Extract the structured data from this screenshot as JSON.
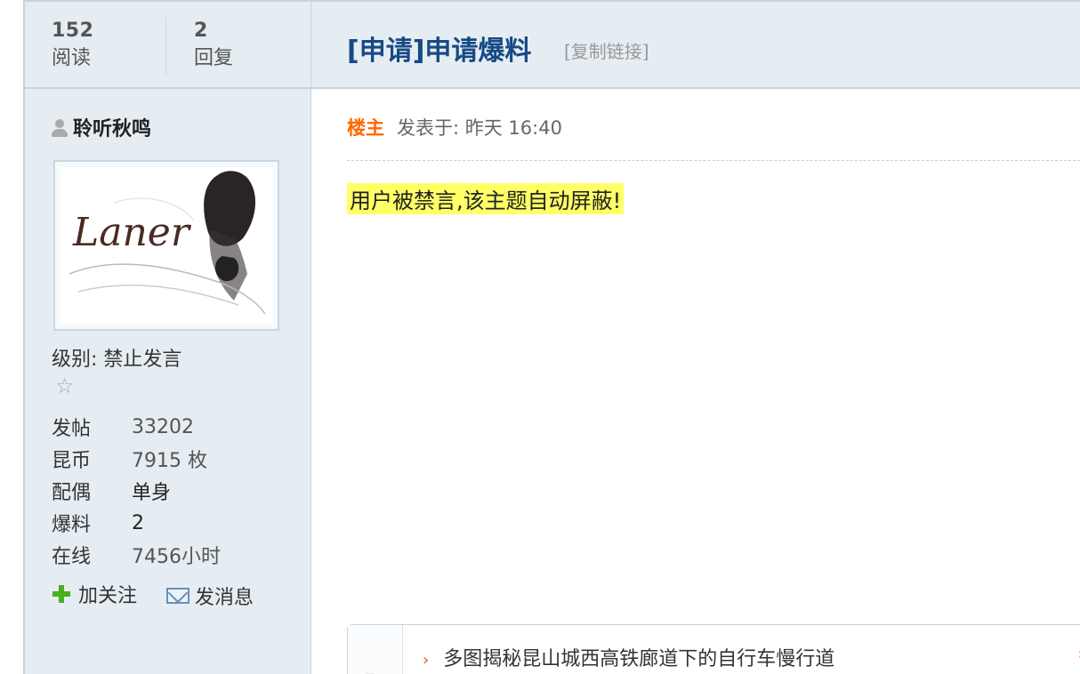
{
  "stats": {
    "reads_count": "152",
    "reads_label": "阅读",
    "replies_count": "2",
    "replies_label": "回复"
  },
  "thread": {
    "title": "[申请]申请爆料",
    "copy_link": "[复制链接]"
  },
  "user": {
    "name": "聆听秋鸣",
    "avatar_text": "Laner",
    "level": "级别: 禁止发言",
    "profile": [
      {
        "key": "发帖",
        "value": "33202"
      },
      {
        "key": "昆币",
        "value": "7915 枚"
      },
      {
        "key": "配偶",
        "value": "单身"
      },
      {
        "key": "爆料",
        "value": "2"
      },
      {
        "key": "在线",
        "value": "7456小时"
      }
    ],
    "follow_label": "加关注",
    "message_label": "发消息"
  },
  "post": {
    "owner_tag": "楼主",
    "posted_at": "发表于: 昨天 16:40",
    "body": "用户被禁言,该主题自动屏蔽!"
  },
  "related": {
    "items": [
      "多图揭秘昆山城西高铁廊道下的自行车慢行道"
    ]
  }
}
